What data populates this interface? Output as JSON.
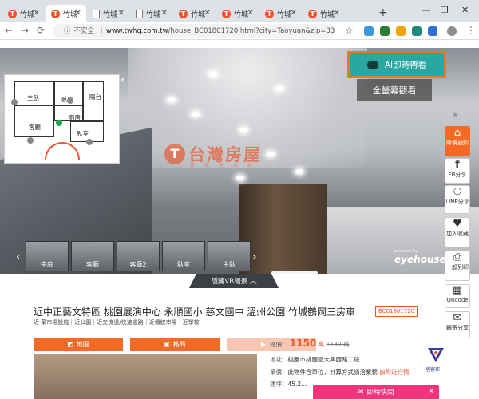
{
  "browser": {
    "tabs": [
      {
        "label": "竹城",
        "icon": "taiwanhouse-icon"
      },
      {
        "label": "竹城",
        "icon": "taiwanhouse-icon",
        "active": true
      },
      {
        "label": "竹城",
        "icon": "document-icon"
      },
      {
        "label": "竹城",
        "icon": "document-icon"
      },
      {
        "label": "竹城",
        "icon": "taiwanhouse-icon"
      },
      {
        "label": "竹城",
        "icon": "taiwanhouse-icon"
      },
      {
        "label": "竹城",
        "icon": "taiwanhouse-icon"
      },
      {
        "label": "竹城",
        "icon": "taiwanhouse-icon"
      }
    ],
    "new_tab": "+",
    "insecure_label": "不安全",
    "url_domain": "www.twhg.com.tw",
    "url_path": "/house_BC01801720.html?city=Taoyuan&zip=330&ty..."
  },
  "viewer": {
    "ai_button": "AI即時帶看",
    "fullscreen_button": "全螢幕觀看",
    "watermark_brand": "台灣房屋",
    "watermark_sub": "愛家愛地球",
    "powered_by": "powered by",
    "vendor": "eyehouse",
    "hide_vr": "隱藏VR場景",
    "thumbnails": [
      "中庭",
      "客廳",
      "客廳2",
      "臥室",
      "主臥"
    ],
    "floorplan_rooms": [
      "主臥",
      "臥室",
      "客廳",
      "廚房",
      "臥室",
      "陽台"
    ]
  },
  "sidebar": [
    {
      "icon": "price-tag-icon",
      "label": "降價通知"
    },
    {
      "icon": "facebook-icon",
      "label": "FB分享"
    },
    {
      "icon": "line-icon",
      "label": "LINE分享"
    },
    {
      "icon": "heart-icon",
      "label": "加入收藏"
    },
    {
      "icon": "print-icon",
      "label": "一般列印"
    },
    {
      "icon": "qrcode-icon",
      "label": "QRcode"
    },
    {
      "icon": "mail-icon",
      "label": "轉寄分享"
    }
  ],
  "listing": {
    "title": "近中正藝文特區 桃園展演中心 永順國小 慈文國中 溫州公園 竹城鶴岡三房車",
    "code": "BC01801720",
    "sublinks": "近 菜市場設施｜近公園｜近交流道/快速道路｜近傳統市場｜近學校",
    "tabs": [
      "地圖",
      "格局",
      "影音"
    ],
    "total_price_label": "總價：",
    "price": "1150",
    "price_unit": "萬",
    "old_price": "1180 萬",
    "address_label": "地址：",
    "address": "桃園市桃園區大興西路二段",
    "unit_label": "單價：",
    "unit": "此物件含車位，計算方式請洽業務",
    "nearby": "附近行情",
    "building_label": "建坪：",
    "building": "45.2..."
  },
  "pixnet_label": "痞客邦",
  "quick_ask": "即時快問"
}
